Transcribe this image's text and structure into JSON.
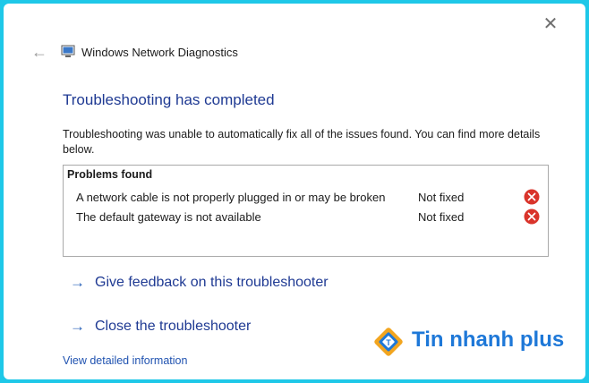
{
  "window": {
    "title": "Windows Network Diagnostics",
    "close_glyph": "✕",
    "back_glyph": "←"
  },
  "heading": "Troubleshooting has completed",
  "description": "Troubleshooting was unable to automatically fix all of the issues found. You can find more details below.",
  "problems": {
    "title": "Problems found",
    "items": [
      {
        "text": "A network cable is not properly plugged in or may be broken",
        "status": "Not fixed",
        "icon": "error-icon"
      },
      {
        "text": "The default gateway is not available",
        "status": "Not fixed",
        "icon": "error-icon"
      }
    ]
  },
  "links": {
    "feedback": "Give feedback on this troubleshooter",
    "close": "Close the troubleshooter",
    "arrow": "→",
    "details": "View detailed information"
  },
  "watermark": {
    "text": "Tin nhanh plus"
  },
  "colors": {
    "accent": "#1f3a93",
    "link": "#1f52b0",
    "error": "#d9342b",
    "frame": "#1ec8e8",
    "watermark": "#1e78d8"
  }
}
